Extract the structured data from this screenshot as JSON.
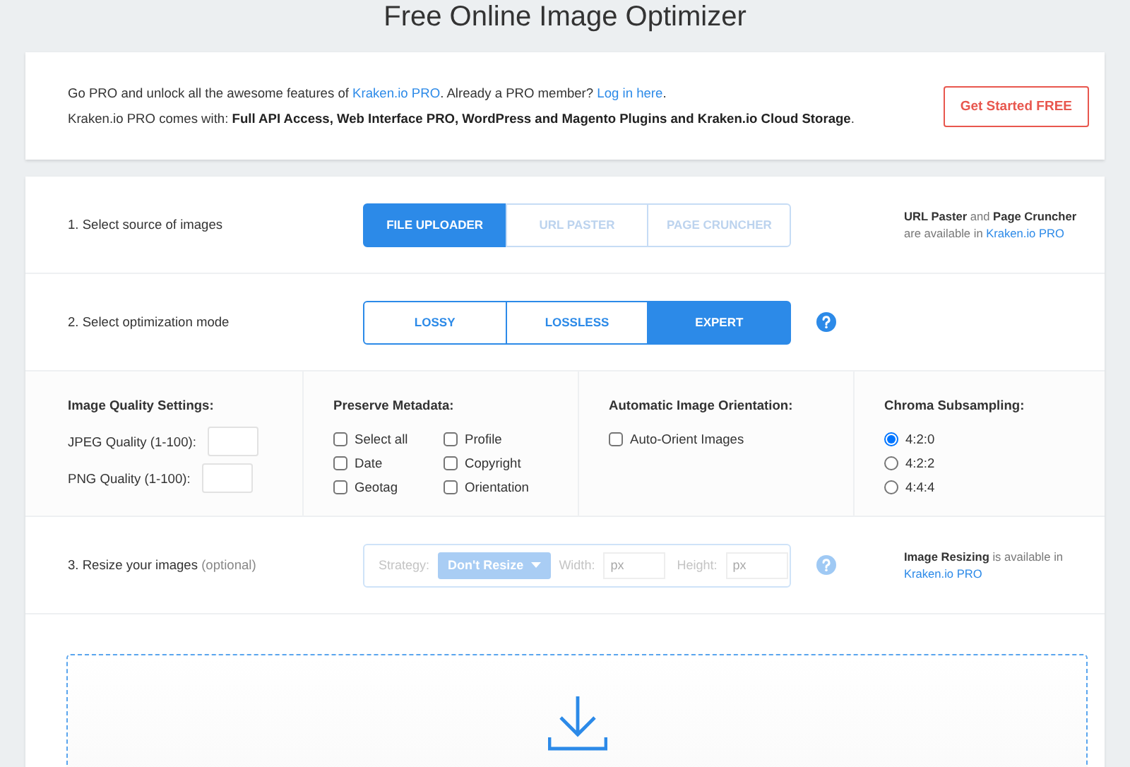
{
  "title": "Free Online Image Optimizer",
  "promo": {
    "line_1": [
      {
        "kind": "text",
        "text": "Go PRO and unlock all the awesome features of "
      },
      {
        "kind": "link",
        "text": "Kraken.io PRO"
      },
      {
        "kind": "text",
        "text": ". Already a PRO member? "
      },
      {
        "kind": "link",
        "text": "Log in here"
      },
      {
        "kind": "text",
        "text": "."
      }
    ],
    "line_2": "Kraken.io PRO comes with: **Full API Access, Web Interface PRO, WordPress and Magento Plugins and Kraken.io Cloud Storage**.",
    "button": "Get Started FREE"
  },
  "source": {
    "label": "1. Select source of images",
    "options": [
      {
        "label": "FILE UPLOADER",
        "selected": true,
        "disabled": false
      },
      {
        "label": "URL PASTER",
        "selected": false,
        "disabled": true
      },
      {
        "label": "PAGE CRUNCHER",
        "selected": false,
        "disabled": true
      }
    ],
    "note": [
      {
        "kind": "bold",
        "text": "URL Paster"
      },
      {
        "kind": "text",
        "text": " and "
      },
      {
        "kind": "bold",
        "text": "Page Cruncher"
      },
      {
        "kind": "break"
      },
      {
        "kind": "text",
        "text": "are available in "
      },
      {
        "kind": "link",
        "text": "Kraken.io PRO"
      }
    ]
  },
  "mode": {
    "label": "2. Select optimization mode",
    "options": [
      {
        "label": "LOSSY",
        "selected": false,
        "disabled": false
      },
      {
        "label": "LOSSLESS",
        "selected": false,
        "disabled": false
      },
      {
        "label": "EXPERT",
        "selected": true,
        "disabled": false
      }
    ]
  },
  "settings": {
    "quality": {
      "title": "Image Quality Settings:",
      "fields": [
        {
          "label": "JPEG Quality (1-100):"
        },
        {
          "label": "PNG Quality (1-100):"
        }
      ]
    },
    "metadata": {
      "title": "Preserve Metadata:",
      "options": [
        {
          "label": "Select all",
          "checked": false
        },
        {
          "label": "Date",
          "checked": false
        },
        {
          "label": "Geotag",
          "checked": false
        },
        {
          "label": "Profile",
          "checked": false
        },
        {
          "label": "Copyright",
          "checked": false
        },
        {
          "label": "Orientation",
          "checked": false
        }
      ]
    },
    "orientation": {
      "title": "Automatic Image Orientation:",
      "options": [
        {
          "label": "Auto-Orient Images",
          "checked": false
        }
      ]
    },
    "chroma": {
      "title": "Chroma Subsampling:",
      "options": [
        {
          "label": "4:2:0",
          "selected": true
        },
        {
          "label": "4:2:2",
          "selected": false
        },
        {
          "label": "4:4:4",
          "selected": false
        }
      ]
    }
  },
  "resize": {
    "label": "3. Resize your images",
    "optional": "(optional)",
    "disabled": true,
    "strategy_label": "Strategy:",
    "strategy": "Don't Resize",
    "width_label": "Width:",
    "width_placeholder": "px",
    "height_label": "Height:",
    "height_placeholder": "px",
    "note": [
      {
        "kind": "bold",
        "text": "Image Resizing"
      },
      {
        "kind": "text",
        "text": " is available in"
      },
      {
        "kind": "break"
      },
      {
        "kind": "link",
        "text": "Kraken.io PRO"
      }
    ]
  }
}
